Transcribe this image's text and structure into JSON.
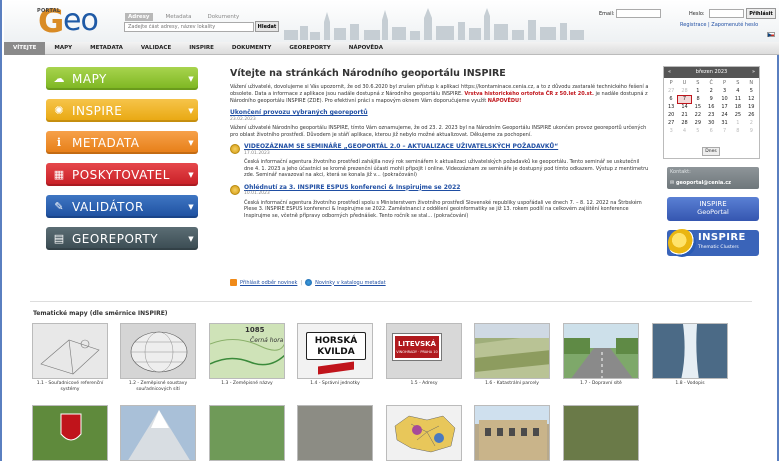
{
  "header": {
    "logo": {
      "portal": "PORTAL",
      "g": "G",
      "eo": "eo"
    },
    "search_tabs": [
      "Adresy",
      "Metadata",
      "Dokumenty"
    ],
    "search_placeholder": "Zadejte část adresy, název lokality",
    "search_button": "Hledat",
    "login": {
      "email_label": "Email:",
      "password_label": "Heslo:",
      "login_button": "Přihlásit",
      "register": "Registrace",
      "separator": "|",
      "forgot": "Zapomenuté heslo"
    }
  },
  "nav": [
    "VÍTEJTE",
    "MAPY",
    "METADATA",
    "VALIDACE",
    "INSPIRE",
    "DOKUMENTY",
    "GEOREPORTY",
    "NÁPOVĚDA"
  ],
  "left_buttons": [
    {
      "label": "MAPY",
      "icon": "cloud-icon",
      "color": "#7bb520"
    },
    {
      "label": "INSPIRE",
      "icon": "inspire-icon",
      "color": "#e8a70f"
    },
    {
      "label": "METADATA",
      "icon": "info-icon",
      "color": "#e67d15"
    },
    {
      "label": "POSKYTOVATEL",
      "icon": "provider-icon",
      "color": "#c71d25"
    },
    {
      "label": "VALIDÁTOR",
      "icon": "wrench-icon",
      "color": "#1d4f9f"
    },
    {
      "label": "GEOREPORTY",
      "icon": "document-icon",
      "color": "#3a4b52"
    }
  ],
  "main": {
    "title": "Vítejte na stránkách Národního geoportálu INSPIRE",
    "intro_a": "Vážení uživatelé, dovolujeme si Vás upozornit, že od 30.6.2020 byl zrušen přístup k aplikaci https://kontaminace.cenia.cz, a to z důvodu zastaralé technického řešení a obsolete. Data a informace z aplikace jsou nadále dostupná z Národního geoportálu INSPIRE.",
    "intro_red": "Vrstva historického ortofota ČR z 50.let 20.st.",
    "intro_b": "je nadále dostupná z Národního geoportálu INSPIRE (ZDE). Pro efektivní práci s mapovým oknem Vám doporučujeme využít",
    "intro_help": "NÁPOVĚDU!",
    "news": [
      {
        "title": "Ukončení provozu vybraných georeportů",
        "date": "23.02.2023",
        "text": "Vážení uživatelé Národního geoportálu INSPIRE, tímto Vám oznamujeme, že od 23. 2. 2023 byl na Národním Geoportálu INSPIRE ukončen provoz georeportů určených pro oblast životního prostředí. Důvodem je stáří aplikace, kterou již nebylo možné aktualizovat. Děkujeme za pochopení."
      },
      {
        "title": "VIDEOZÁZNAM SE SEMINÁŘE „GEOPORTÁL 2.0 – AKTUALIZACE UŽIVATELSKÝCH POŽADAVKŮ“",
        "date": "17.01.2023",
        "text": "Česká informační agentura životního prostředí zahájila nový rok seminářem k aktualizaci uživatelských požadavků ke geoportálu. Tento seminář se uskutečnil dne 4. 1. 2023 a jeho účastníci se kromě prezenční účasti mohli připojit i online. Videozáznam ze semináře je dostupný pod tímto odkazem. Výstup z mentimetru zde. Seminář navazoval na akci, která se konala již v... (pokračování)"
      },
      {
        "title": "Ohlédnutí za 3. INSPIRE ESPUS konferenci & Inspirujme se 2022",
        "date": "10.01.2023",
        "text": "Česká informační agentura životního prostředí spolu s Ministerstvem životního prostředí Slovenské republiky uspořádali ve dnech 7. – 8. 12. 2022 na Štrbském Plese 3. INSPIRE ESPUS konferenci & Inspirujme se 2022. Zaměstnanci z oddělení geoinformatiky se již 13. rokem podílí na celkovém zajištění konference Inspirujme se, včetně přípravy odborných přednášek. Tento ročník se stal... (pokračování)"
      }
    ],
    "rss_label": "Přihlásit odběr novinek",
    "rss_sep": "|",
    "metadata_news_label": "Novinky v katalogu metadat"
  },
  "calendar": {
    "month": "březen 2023",
    "prev": "«",
    "next": "»",
    "weekdays": [
      "P",
      "U",
      "S",
      "Č",
      "P",
      "S",
      "N"
    ],
    "weeks": [
      [
        {
          "d": "27",
          "o": true
        },
        {
          "d": "28",
          "o": true
        },
        {
          "d": "1"
        },
        {
          "d": "2"
        },
        {
          "d": "3"
        },
        {
          "d": "4"
        },
        {
          "d": "5"
        }
      ],
      [
        {
          "d": "6"
        },
        {
          "d": "7",
          "t": true
        },
        {
          "d": "8"
        },
        {
          "d": "9"
        },
        {
          "d": "10"
        },
        {
          "d": "11"
        },
        {
          "d": "12"
        }
      ],
      [
        {
          "d": "13"
        },
        {
          "d": "14"
        },
        {
          "d": "15"
        },
        {
          "d": "16"
        },
        {
          "d": "17"
        },
        {
          "d": "18"
        },
        {
          "d": "19"
        }
      ],
      [
        {
          "d": "20"
        },
        {
          "d": "21"
        },
        {
          "d": "22"
        },
        {
          "d": "23"
        },
        {
          "d": "24"
        },
        {
          "d": "25"
        },
        {
          "d": "26"
        }
      ],
      [
        {
          "d": "27"
        },
        {
          "d": "28"
        },
        {
          "d": "29"
        },
        {
          "d": "30"
        },
        {
          "d": "31"
        },
        {
          "d": "1",
          "o": true
        },
        {
          "d": "2",
          "o": true
        }
      ],
      [
        {
          "d": "3",
          "o": true
        },
        {
          "d": "4",
          "o": true
        },
        {
          "d": "5",
          "o": true
        },
        {
          "d": "6",
          "o": true
        },
        {
          "d": "7",
          "o": true
        },
        {
          "d": "8",
          "o": true
        },
        {
          "d": "9",
          "o": true
        }
      ]
    ],
    "today_button": "Dnes"
  },
  "contact": {
    "label": "Kontakt:",
    "email": "geoportal@cenia.cz"
  },
  "banner_inspire": {
    "line1": "INSPIRE",
    "line2": "GeoPortal"
  },
  "banner_tc": {
    "line1": "INSPIRE",
    "line2": "Thematic Clusters"
  },
  "thematic": {
    "title": "Tematické mapy (dle směrnice INSPIRE)",
    "thumb_texts": {
      "signs": "HORSKÁ KVILDA",
      "street": "LITEVSKÁ",
      "street_sub": "VINOHRADY · PRAHA 10",
      "map_num": "1085",
      "map_word": "Černá hora"
    },
    "items": [
      {
        "caption": "1.1 - Souřadnicové referenční systémy",
        "bg": "#e8e8e8"
      },
      {
        "caption": "1.2 - Zeměpisné soustavy souřadnicových sítí",
        "bg": "#d5d5d5"
      },
      {
        "caption": "1.3 - Zeměpisné názvy",
        "bg": "#cfe3b8"
      },
      {
        "caption": "1.4 - Správní jednotky",
        "bg": "#f2f2f2"
      },
      {
        "caption": "1.5 - Adresy",
        "bg": "#d8d8d8"
      },
      {
        "caption": "1.6 - Katastrální parcely",
        "bg": "#9fae7a"
      },
      {
        "caption": "1.7 - Dopravní sítě",
        "bg": "#7ea86a"
      },
      {
        "caption": "1.8 - Vodopis",
        "bg": "#6e8fb0"
      },
      {
        "caption": "",
        "bg": "#5f8a3c"
      },
      {
        "caption": "",
        "bg": "#7d8fa8"
      },
      {
        "caption": "",
        "bg": "#6f9a58"
      },
      {
        "caption": "",
        "bg": "#8c8c84"
      },
      {
        "caption": "",
        "bg": "#f1f1f1"
      },
      {
        "caption": "",
        "bg": "#b8a98a"
      },
      {
        "caption": "",
        "bg": "#6a7a48"
      }
    ]
  }
}
